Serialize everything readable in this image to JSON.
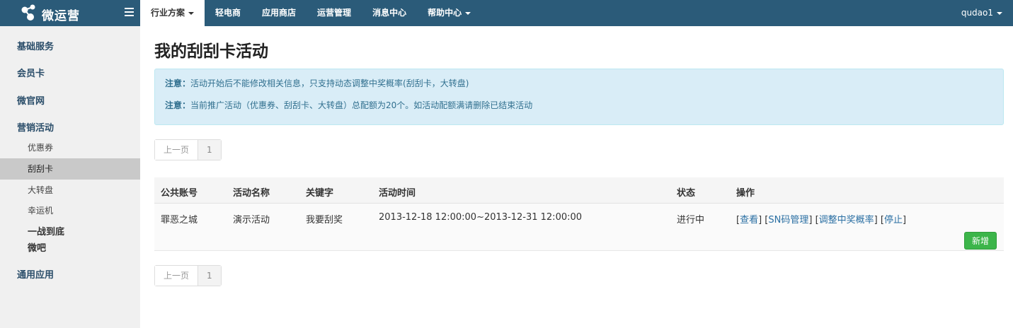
{
  "brand": {
    "name": "微运营",
    "logo_icon": "share-nodes-icon"
  },
  "nav": {
    "items": [
      {
        "label": "行业方案",
        "active": true,
        "dropdown": true
      },
      {
        "label": "轻电商"
      },
      {
        "label": "应用商店"
      },
      {
        "label": "运营管理"
      },
      {
        "label": "消息中心"
      },
      {
        "label": "帮助中心",
        "dropdown": true
      }
    ],
    "user": "qudao1"
  },
  "sidebar": {
    "groups": [
      "基础服务",
      "会员卡",
      "微官网",
      "营销活动"
    ],
    "sub_items": [
      "优惠券",
      "刮刮卡",
      "大转盘",
      "幸运机"
    ],
    "active_sub": "刮刮卡",
    "strong_items": [
      "一战到底",
      "微吧"
    ],
    "footer_group": "通用应用"
  },
  "page": {
    "title": "我的刮刮卡活动"
  },
  "alert": {
    "line1_label": "注意：",
    "line1_text": "活动开始后不能修改相关信息，只支持动态调整中奖概率(刮刮卡，大转盘)",
    "line2_label": "注意：",
    "line2_text": "当前推广活动（优惠券、刮刮卡、大转盘）总配额为20个。如活动配额满请删除已结束活动"
  },
  "pager": {
    "prev": "上一页",
    "page": "1"
  },
  "table": {
    "headers": [
      "公共账号",
      "活动名称",
      "关键字",
      "活动时间",
      "状态",
      "操作"
    ],
    "rows": [
      {
        "account": "罪恶之城",
        "name": "演示活动",
        "keyword": "我要刮奖",
        "time": "2013-12-18 12:00:00~2013-12-31 12:00:00",
        "status": "进行中",
        "ops": [
          "查看",
          "SN码管理",
          "调整中奖概率",
          "停止"
        ]
      }
    ],
    "add_label": "新增"
  },
  "colors": {
    "topbar": "#2b5b79",
    "alert_bg": "#d9edf7",
    "alert_text": "#31708f",
    "link": "#2a6fa3",
    "add_button": "#3cb54a"
  }
}
